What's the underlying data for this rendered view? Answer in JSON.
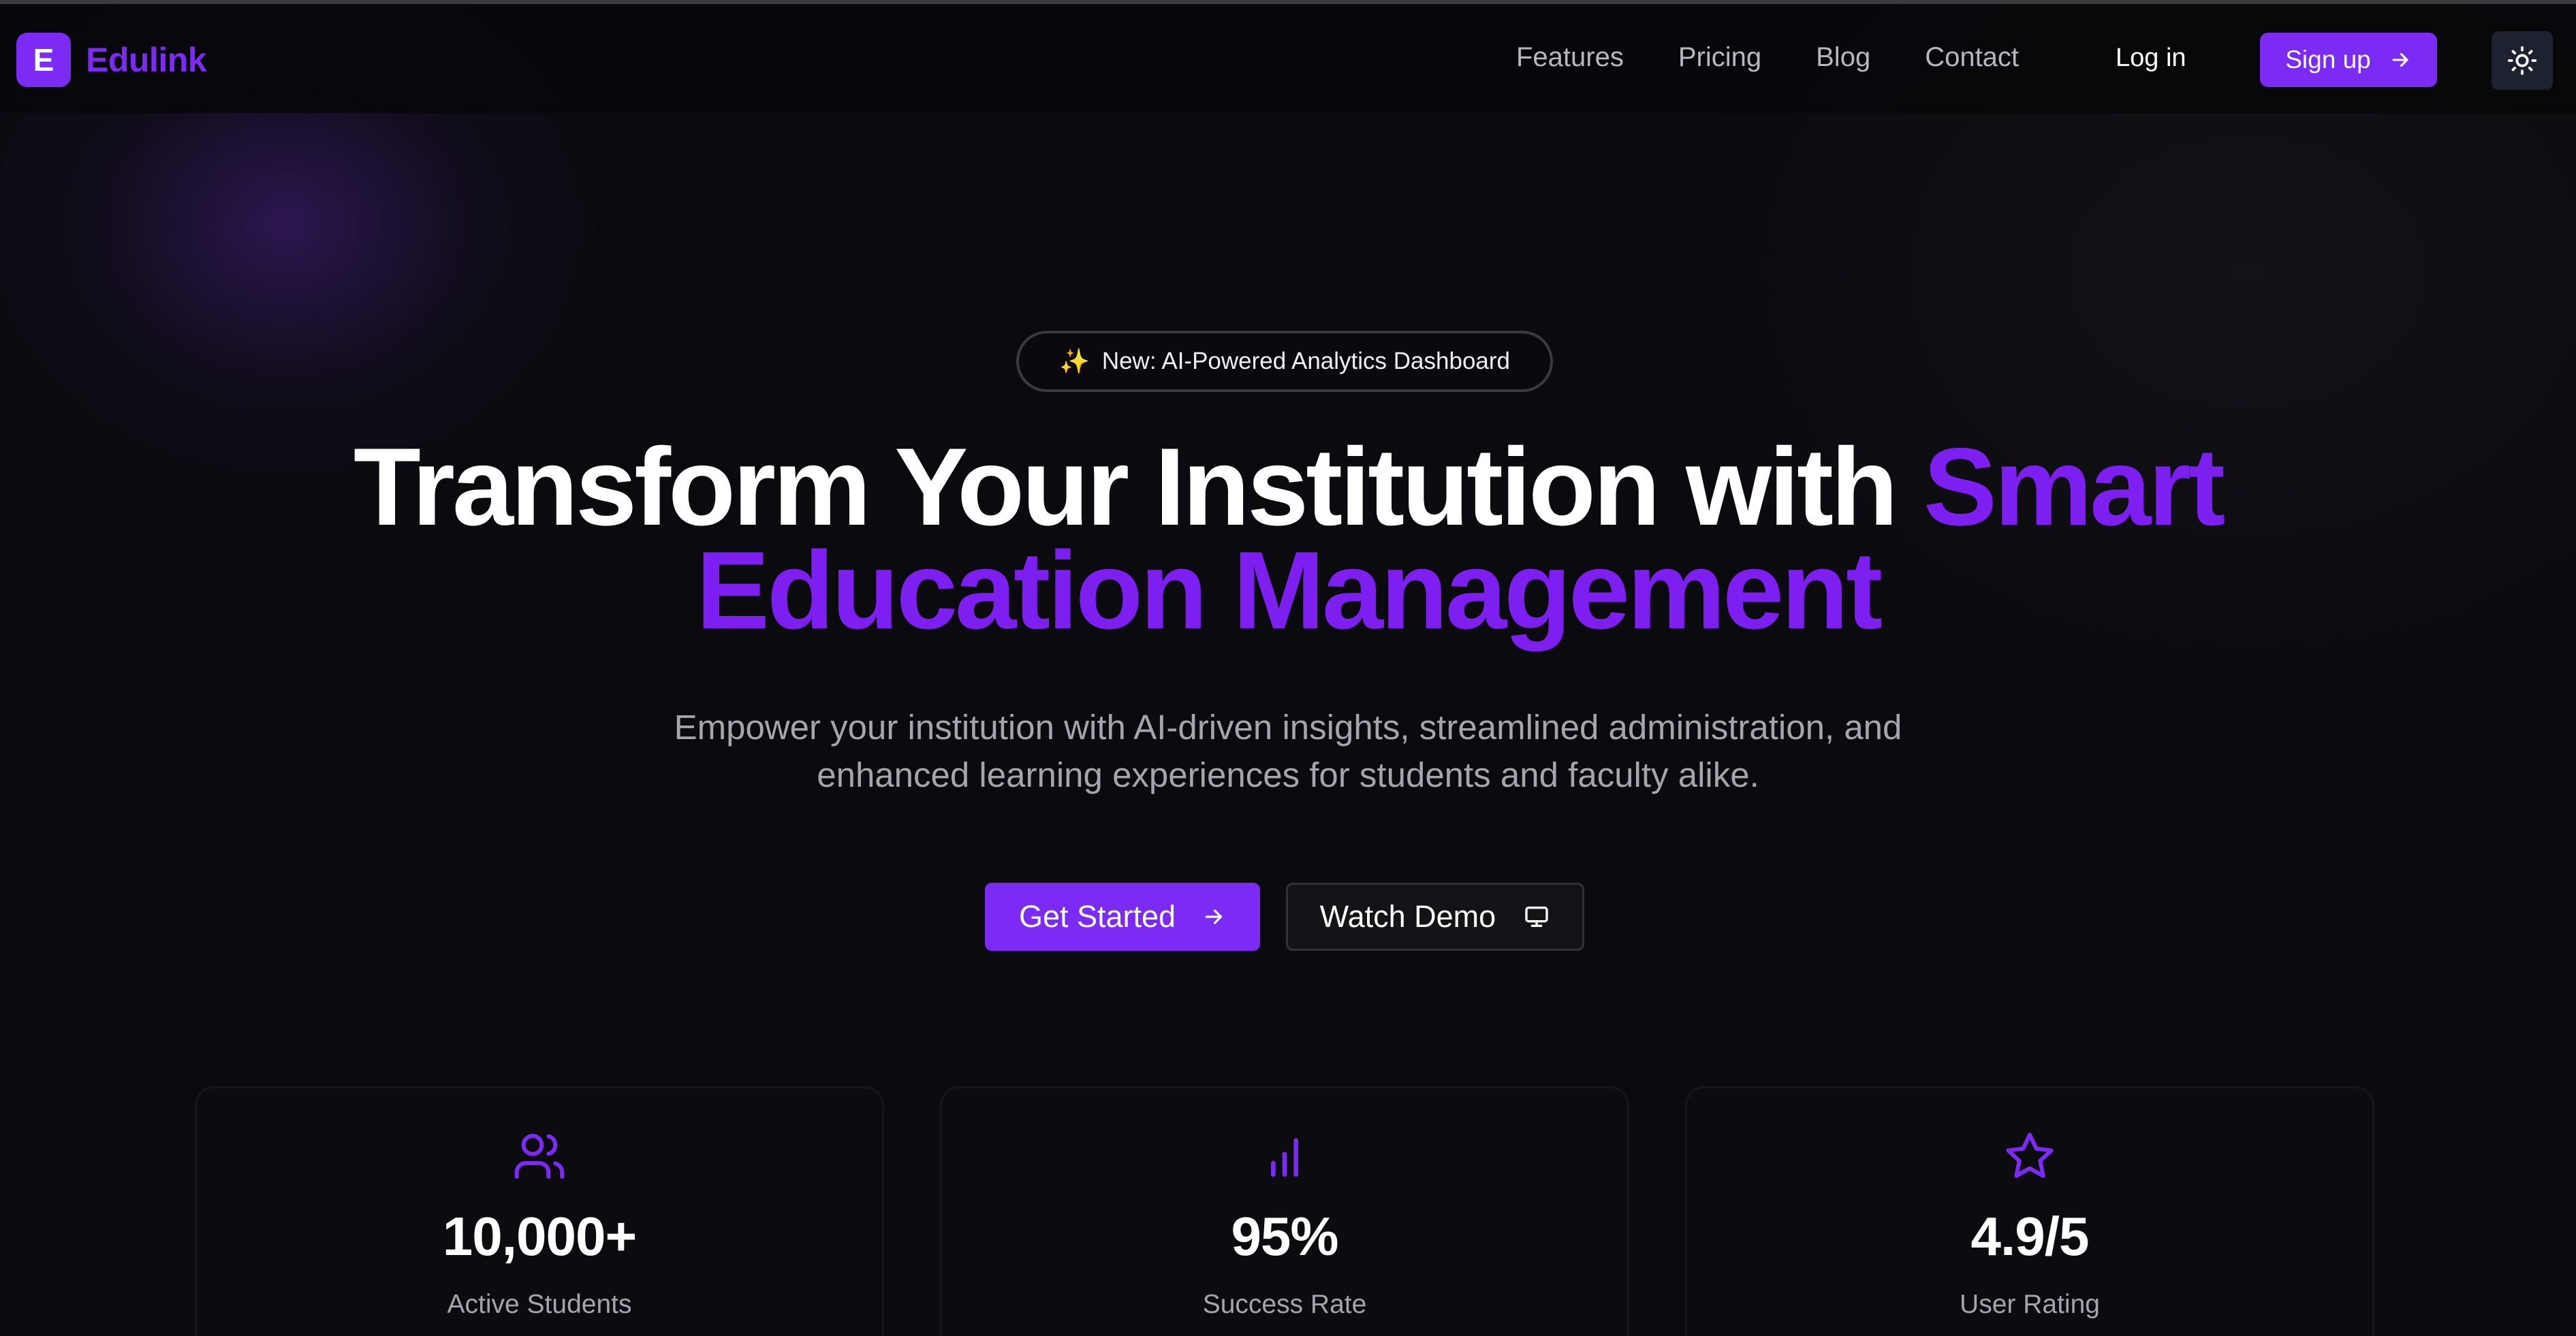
{
  "brand": {
    "initial": "E",
    "name": "Edulink",
    "accent_color": "#7c2bf5"
  },
  "nav": {
    "links": [
      "Features",
      "Pricing",
      "Blog",
      "Contact"
    ],
    "login_label": "Log in",
    "signup_label": "Sign up",
    "theme_toggle_icon": "sun-icon"
  },
  "hero": {
    "badge": {
      "icon": "✨",
      "text": "New: AI-Powered Analytics Dashboard"
    },
    "headline": {
      "line1_white": "Transform Your Institution with ",
      "line1_accent": "Smart",
      "line2_accent": "Education Management"
    },
    "subtext_line1": "Empower your institution with AI-driven insights, streamlined administration, and",
    "subtext_line2": "enhanced learning experiences for students and faculty alike.",
    "primary_cta": {
      "label": "Get Started",
      "icon": "arrow-right-icon"
    },
    "secondary_cta": {
      "label": "Watch Demo",
      "icon": "monitor-icon"
    }
  },
  "stats": [
    {
      "icon": "users-icon",
      "value": "10,000+",
      "label": "Active Students"
    },
    {
      "icon": "bar-chart-icon",
      "value": "95%",
      "label": "Success Rate"
    },
    {
      "icon": "star-icon",
      "value": "4.9/5",
      "label": "User Rating"
    }
  ]
}
